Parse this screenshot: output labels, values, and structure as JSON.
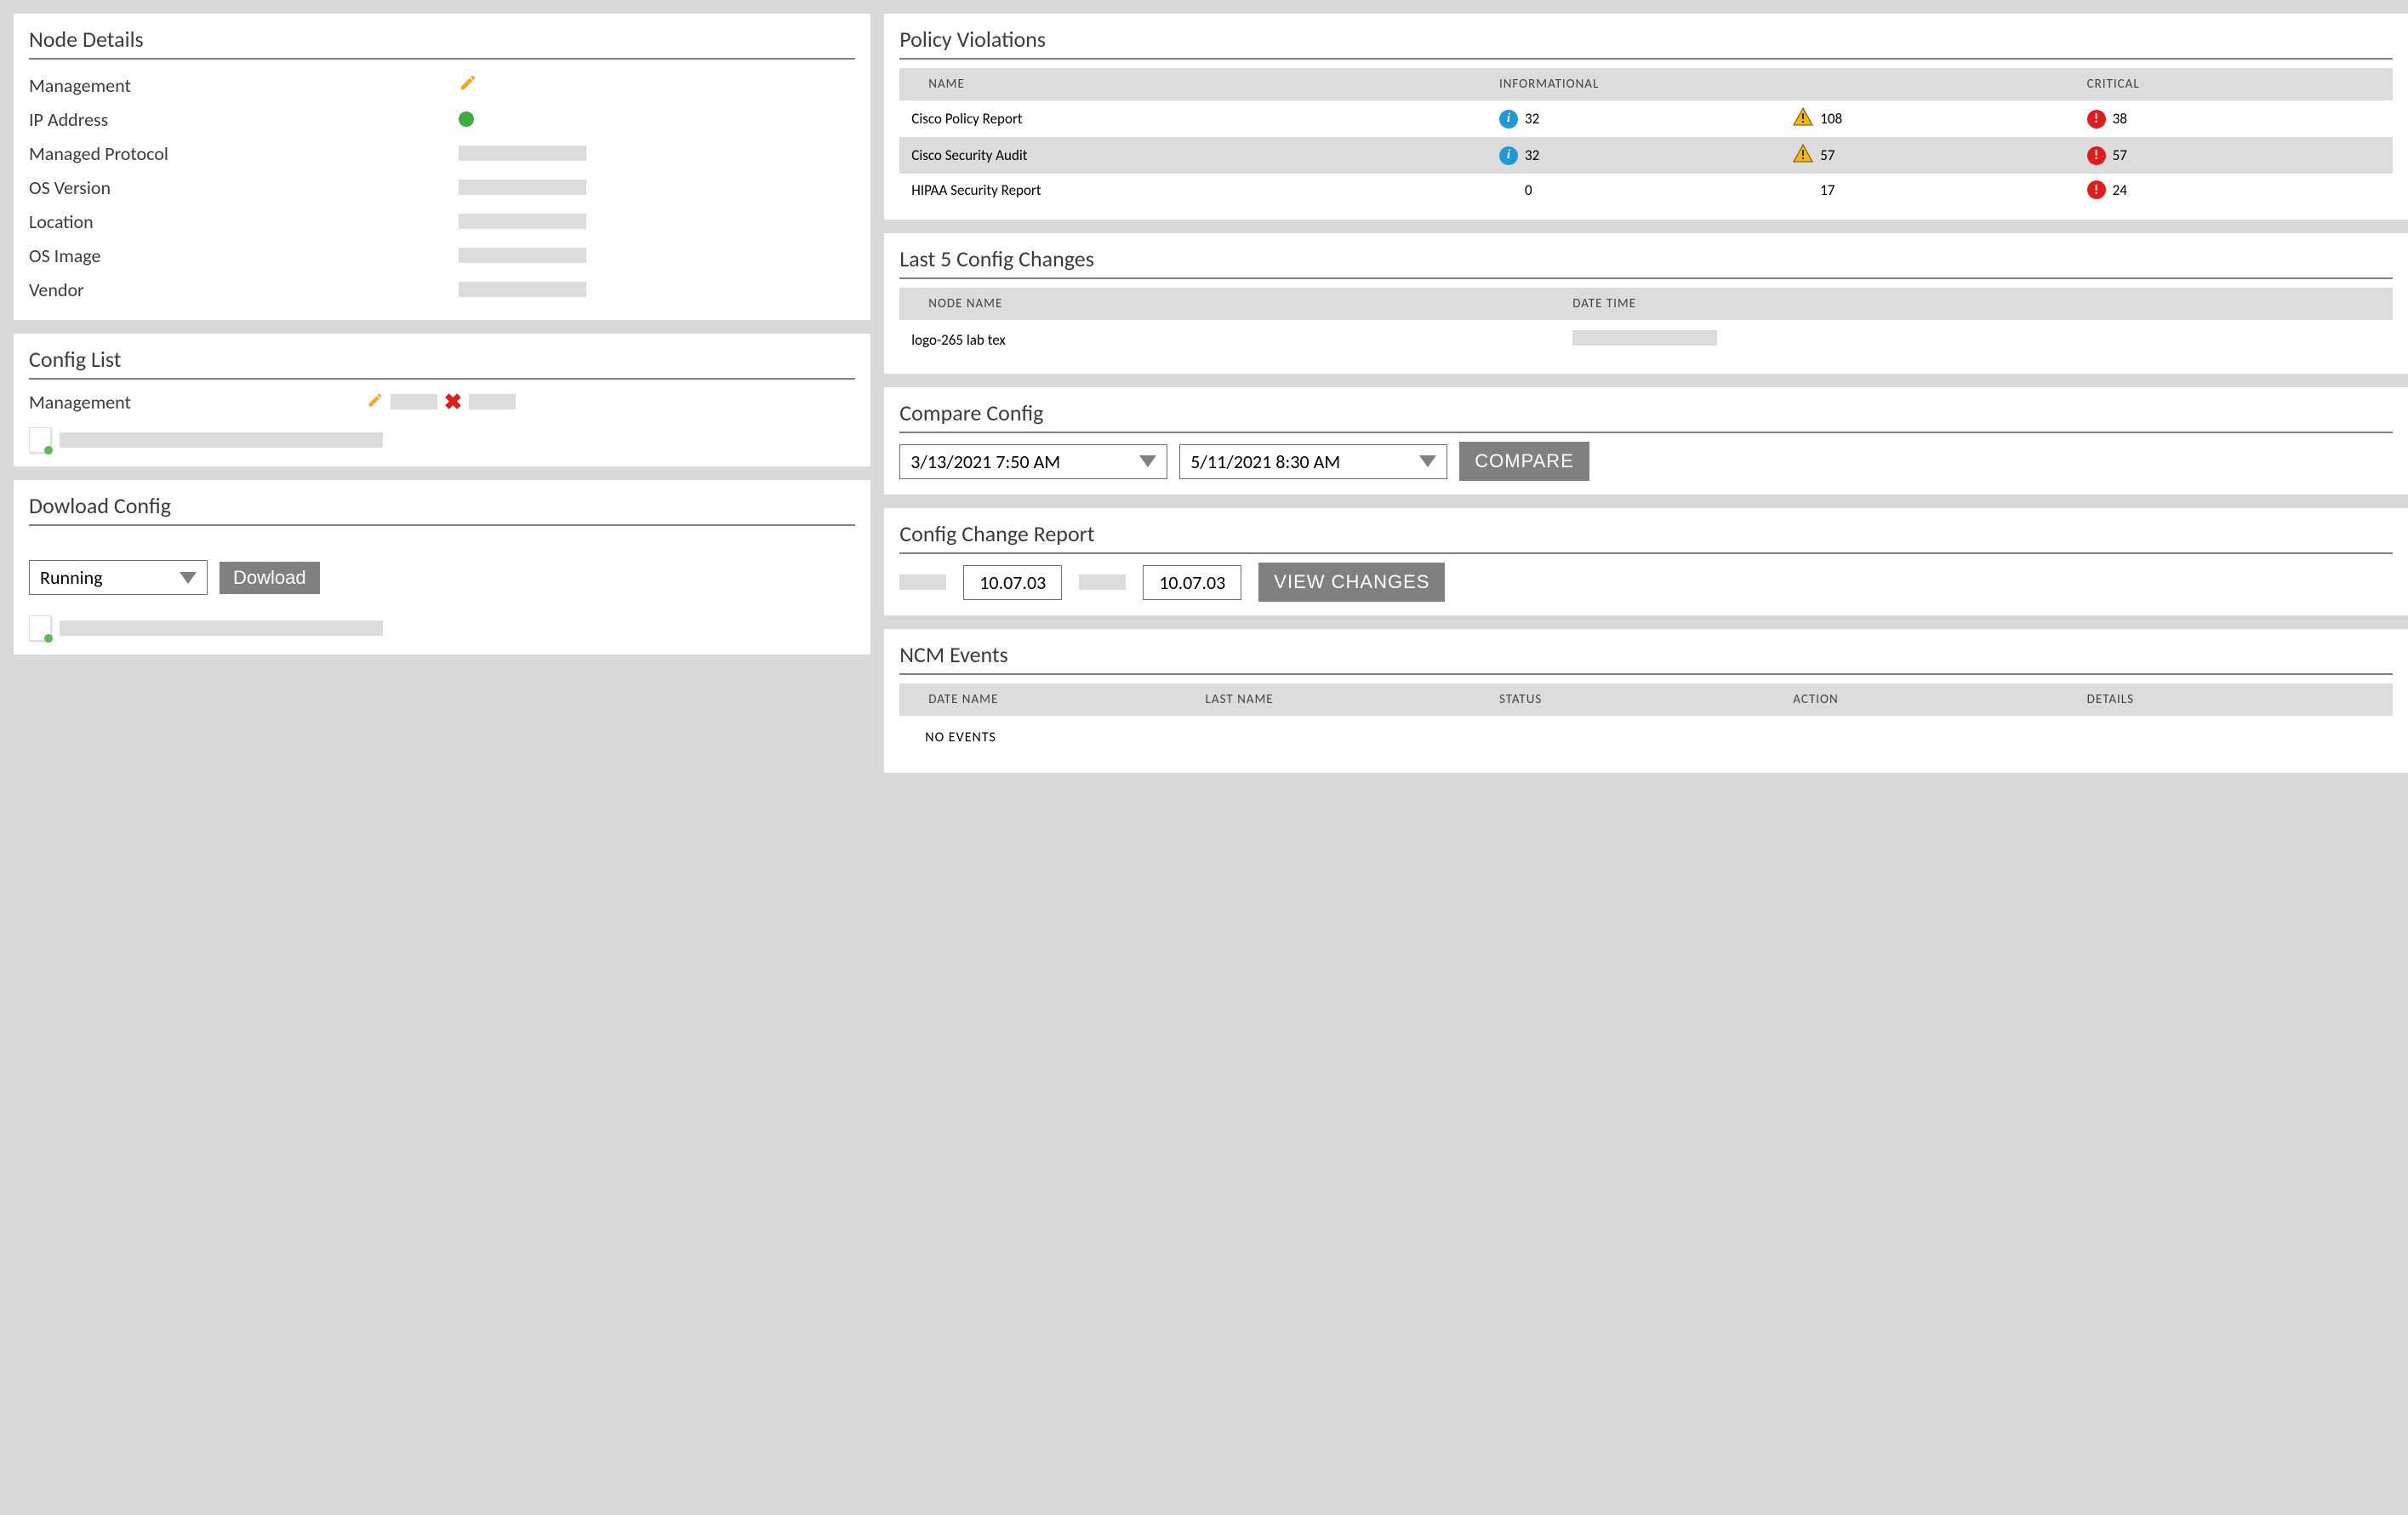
{
  "nodeDetails": {
    "title": "Node Details",
    "rows": [
      {
        "label": "Management"
      },
      {
        "label": "IP Address"
      },
      {
        "label": "Managed Protocol"
      },
      {
        "label": "OS Version"
      },
      {
        "label": "Location"
      },
      {
        "label": "OS Image"
      },
      {
        "label": "Vendor"
      }
    ]
  },
  "configList": {
    "title": "Config List",
    "management_label": "Management"
  },
  "downloadConfig": {
    "title": "Dowload Config",
    "select_value": "Running",
    "button": "Dowload"
  },
  "policyViolations": {
    "title": "Policy Violations",
    "cols": {
      "name": "NAME",
      "info": "INFORMATIONAL",
      "warn": "",
      "crit": "CRITICAL"
    },
    "rows": [
      {
        "name": "Cisco Policy Report",
        "info": "32",
        "warn": "108",
        "crit": "38",
        "infoIcon": true,
        "warnIcon": true,
        "critIcon": true
      },
      {
        "name": "Cisco Security Audit",
        "info": "32",
        "warn": "57",
        "crit": "57",
        "infoIcon": true,
        "warnIcon": true,
        "critIcon": true
      },
      {
        "name": "HIPAA Security Report",
        "info": "0",
        "warn": "17",
        "crit": "24",
        "infoIcon": false,
        "warnIcon": false,
        "critIcon": true
      }
    ]
  },
  "last5": {
    "title": "Last 5 Config Changes",
    "cols": {
      "node": "NODE NAME",
      "dt": "DATE TIME"
    },
    "rows": [
      {
        "node": "logo-265 lab tex"
      }
    ]
  },
  "compare": {
    "title": "Compare Config",
    "from": "3/13/2021 7:50 AM",
    "to": "5/11/2021 8:30 AM",
    "button": "COMPARE"
  },
  "changeReport": {
    "title": "Config Change Report",
    "v1": "10.07.03",
    "v2": "10.07.03",
    "button": "VIEW CHANGES"
  },
  "ncm": {
    "title": "NCM Events",
    "cols": {
      "dn": "DATE NAME",
      "ln": "LAST NAME",
      "st": "STATUS",
      "ac": "ACTION",
      "de": "DETAILS"
    },
    "empty": "NO EVENTS"
  }
}
